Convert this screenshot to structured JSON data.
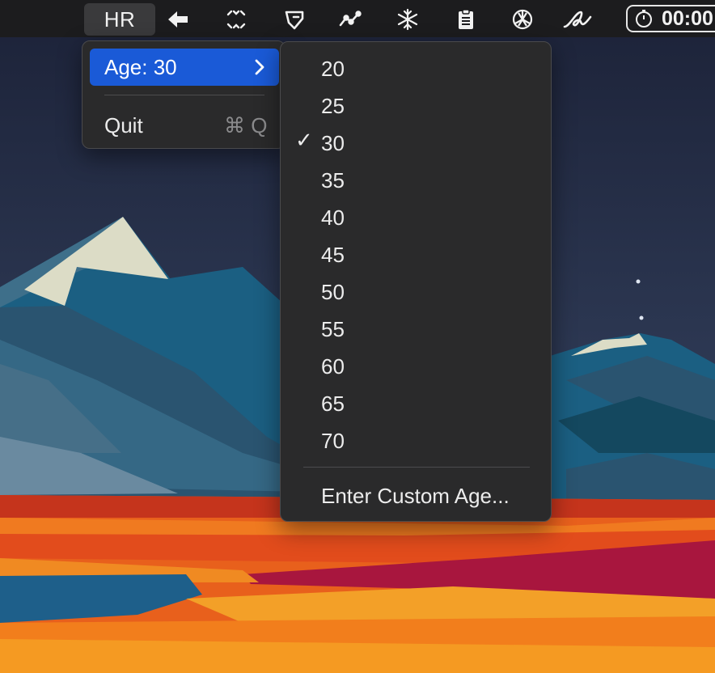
{
  "menubar": {
    "app_label": "HR",
    "icons": [
      "arrow-left-icon",
      "focus-frame-icon",
      "tag-tool-icon",
      "chart-line-icon",
      "snowflake-icon",
      "clipboard-icon",
      "openai-icon",
      "signature-icon"
    ],
    "timer_text": "00:00"
  },
  "main_menu": {
    "age_item": "Age: 30",
    "quit_item": "Quit",
    "quit_shortcut": "⌘ Q"
  },
  "age_submenu": {
    "options": [
      "20",
      "25",
      "30",
      "35",
      "40",
      "45",
      "50",
      "55",
      "60",
      "65",
      "70"
    ],
    "selected": "30",
    "checkmark": "✓",
    "custom_item": "Enter Custom Age..."
  },
  "colors": {
    "menubar_bg": "#1c1c1e",
    "menu_bg": "#2a2a2b",
    "highlight": "#1a5ad7",
    "sky_top": "#1c2238",
    "sky_bottom": "#3a4a68"
  }
}
